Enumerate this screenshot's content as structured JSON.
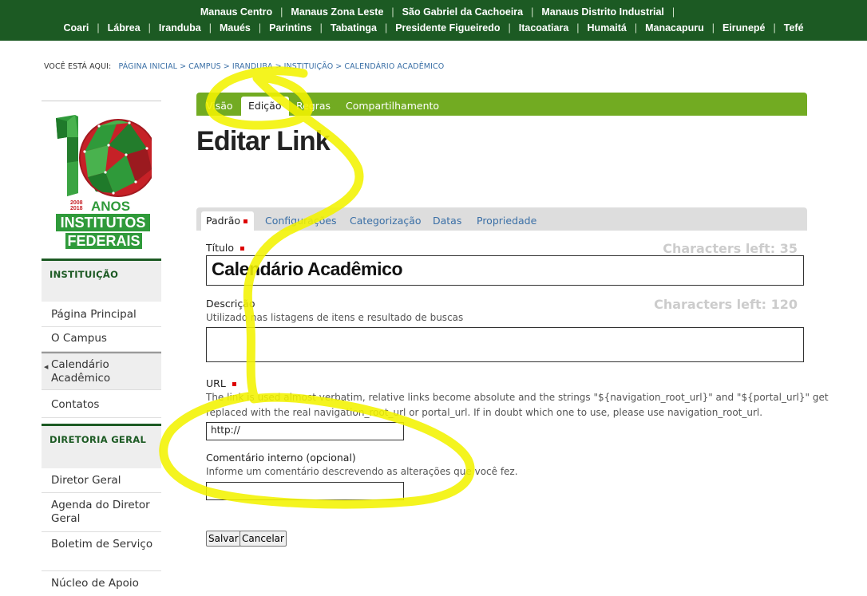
{
  "topnav": {
    "row1": [
      "Manaus Centro",
      "Manaus Zona Leste",
      "São Gabriel da Cachoeira",
      "Manaus Distrito Industrial"
    ],
    "row2": [
      "Coari",
      "Lábrea",
      "Iranduba",
      "Maués",
      "Parintins",
      "Tabatinga",
      "Presidente Figueiredo",
      "Itacoatiara",
      "Humaitá",
      "Manacapuru",
      "Eirunepé",
      "Tefé"
    ],
    "separator": "|"
  },
  "breadcrumb": {
    "label": "VOCÊ ESTÁ AQUI:",
    "items": [
      "PÁGINA INICIAL",
      "CAMPUS",
      "IRANDUBA",
      "INSTITUIÇÃO",
      "CALENDÁRIO ACADÊMICO"
    ],
    "separator": ">"
  },
  "logo": {
    "years": "2008 2018",
    "year_top": "2008",
    "year_bottom": "2018",
    "anos": "ANOS",
    "line1": "INSTITUTOS",
    "line2": "FEDERAIS",
    "number": "10"
  },
  "sidebar": {
    "sections": [
      {
        "heading": "INSTITUIÇÃO",
        "items": [
          "Página Principal",
          "O Campus",
          "Calendário Acadêmico",
          "Contatos"
        ]
      },
      {
        "heading": "DIRETORIA GERAL",
        "items": [
          "Diretor Geral",
          "Agenda do Diretor Geral",
          "Boletim de Serviço",
          "Núcleo de Apoio"
        ]
      }
    ]
  },
  "view_tabs": [
    "Visão",
    "Edição",
    "Regras",
    "Compartilhamento"
  ],
  "page_title": "Editar Link",
  "form_tabs": [
    "Padrão",
    "Configurações",
    "Categorização",
    "Datas",
    "Propriedade"
  ],
  "form": {
    "title_label": "Título",
    "title_chars_left": "Characters left: 35",
    "title_value": "Calendário Acadêmico",
    "desc_label": "Descrição",
    "desc_chars_left": "Characters left: 120",
    "desc_help": "Utilizado nas listagens de itens e resultado de buscas",
    "url_label": "URL",
    "url_help_line1": "The link is used almost verbatim, relative links become absolute and the strings \"${navigation_root_url}\" and \"${portal_url}\" get",
    "url_help_line2": "replaced with the real navigation_root_url or portal_url. If in doubt which one to use, please use navigation_root_url.",
    "url_value": "http://",
    "comment_label": "Comentário interno (opcional)",
    "comment_help": "Informe um comentário descrevendo as alterações que você fez.",
    "save_label": "Salvar",
    "cancel_label": "Cancelar"
  },
  "colors": {
    "top_bar": "#1c5a23",
    "view_tabs": "#72ab22",
    "link": "#3a6fa6",
    "required": "#dd0000",
    "highlight": "#f3f300"
  },
  "active": {
    "view_tab": "Edição",
    "form_tab": "Padrão",
    "sidebar_item": "Calendário Acadêmico"
  }
}
